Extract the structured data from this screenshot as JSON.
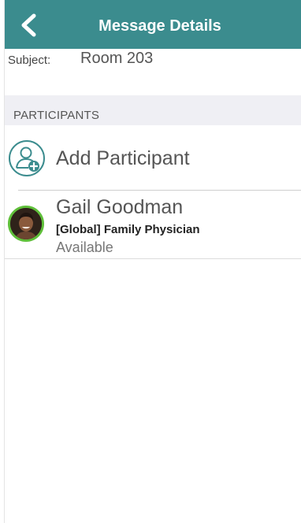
{
  "navbar": {
    "title": "Message Details",
    "back_icon": "chevron-left-icon",
    "background": "#3b8c8e"
  },
  "subject": {
    "label": "Subject:",
    "value": "Room 203"
  },
  "participants": {
    "header": "PARTICIPANTS",
    "add": {
      "label": "Add Participant",
      "icon": "add-user-icon"
    },
    "items": [
      {
        "name": "Gail Goodman",
        "role": "[Global] Family Physician",
        "status": "Available",
        "status_color": "#5fbf3a"
      }
    ]
  }
}
